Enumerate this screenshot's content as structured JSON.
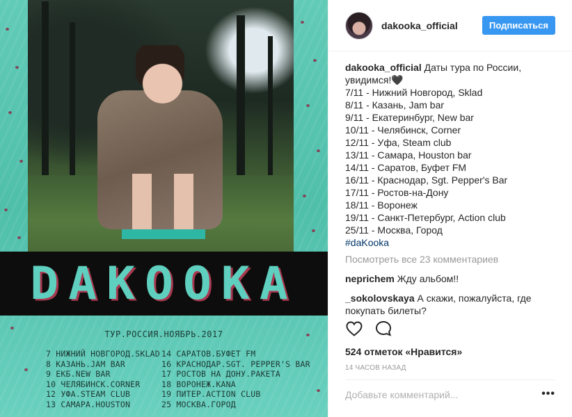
{
  "poster": {
    "band_title": "DAKOOKA",
    "tour_heading": "ТУР.РОССИЯ.НОЯБРЬ.2017",
    "left_dates": [
      "7  НИЖНИЙ НОВГОРОД.SKLAD",
      "8  КАЗАНЬ.JAM BAR",
      "9  ЕКБ.NEW BAR",
      "10 ЧЕЛЯБИНСК.CORNER",
      "12 УФА.STEAM CLUB",
      "13 САМАРА.HOUSTON"
    ],
    "right_dates": [
      "14 САРАТОВ.БУФЕТ FM",
      "16 КРАСНОДАР.SGT. PEPPER'S BAR",
      "17 РОСТОВ НА ДОНУ.РАКЕТА",
      "18 ВОРОНЕЖ.KANA",
      "19 ПИТЕР.ACTION CLUB",
      "25 МОСКВА.ГОРОД"
    ]
  },
  "header": {
    "username": "dakooka_official",
    "follow_label": "Подписаться"
  },
  "caption": {
    "user": "dakooka_official",
    "text": "Даты тура по России, увидимся!🖤",
    "tour_lines": [
      "7/11 - Нижний Новгород, Sklad",
      "8/11 - Казань, Jam bar",
      "9/11 - Екатеринбург, New bar",
      "10/11 - Челябинск, Corner",
      "12/11 - Уфа, Steam club",
      "13/11 - Самара, Houston bar",
      "14/11 - Саратов, Буфет FM",
      "16/11 - Краснодар, Sgt. Pepper's Bar",
      "17/11 - Ростов-на-Дону",
      "18/11 - Воронеж",
      "19/11 - Санкт-Петербург, Action club",
      "25/11 - Москва, Город"
    ],
    "hashtag": "#daKooka"
  },
  "view_all_comments": "Посмотреть все 23 комментариев",
  "comments": [
    {
      "user": "neprichem",
      "text": "Жду альбом!!"
    },
    {
      "user": "_sokolovskaya",
      "text": "А скажи, пожалуйста, где покупать билеты?"
    }
  ],
  "icons": {
    "like": "heart-icon",
    "comment": "speech-bubble-icon",
    "more": "ellipsis-icon"
  },
  "likes_text": "524 отметок «Нравится»",
  "timestamp": "14 часов назад",
  "add_comment_placeholder": "Добавьте комментарий...",
  "more_label": "•••",
  "colors": {
    "accent": "#3897f0",
    "poster_teal": "#58c4b0",
    "title_red": "#a8384f",
    "muted": "#999999"
  }
}
